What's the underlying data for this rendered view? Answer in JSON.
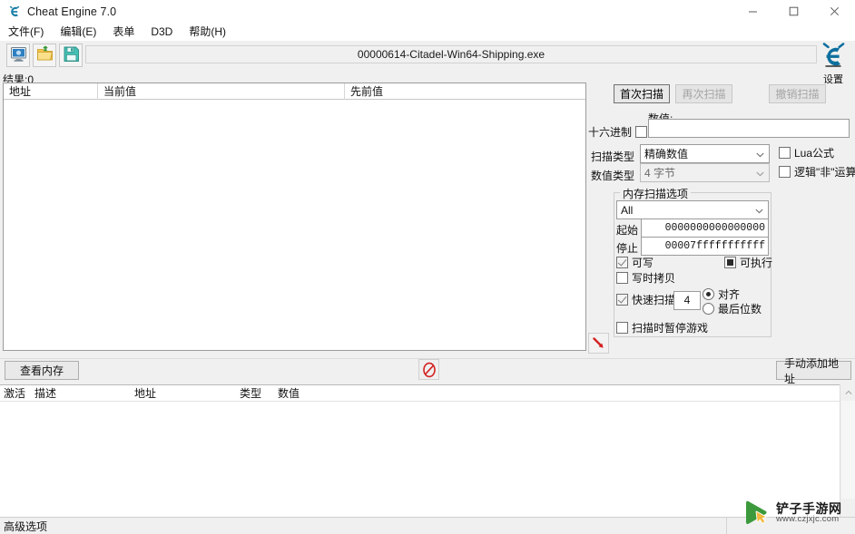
{
  "window": {
    "title": "Cheat Engine 7.0",
    "icon": "cheat-engine-logo-icon",
    "minimize": "–",
    "maximize": "□",
    "close": "✕"
  },
  "menu": {
    "items": [
      {
        "label": "文件(F)",
        "name": "menu-file"
      },
      {
        "label": "编辑(E)",
        "name": "menu-edit"
      },
      {
        "label": "表单",
        "name": "menu-forms"
      },
      {
        "label": "D3D",
        "name": "menu-d3d"
      },
      {
        "label": "帮助(H)",
        "name": "menu-help"
      }
    ]
  },
  "toolbar": {
    "open_process_icon": "monitor-icon",
    "open_file_icon": "open-folder-icon",
    "save_icon": "floppy-save-icon",
    "process_name": "00000614-Citadel-Win64-Shipping.exe"
  },
  "settings": {
    "label": "设置",
    "icon": "cheat-engine-e-icon"
  },
  "results": {
    "count_label": "结果:0",
    "columns": [
      "地址",
      "当前值",
      "先前值"
    ],
    "rows": [],
    "red_arrow_icon": "red-arrow-down-right-icon"
  },
  "scan": {
    "first_scan": "首次扫描",
    "next_scan": "再次扫描",
    "undo_scan": "撤销扫描",
    "hex_label": "十六进制",
    "hex_checked": false,
    "value_label": "数值:",
    "value": "",
    "scan_type_label": "扫描类型",
    "scan_type_value": "精确数值",
    "value_type_label": "数值类型",
    "value_type_value": "4 字节",
    "lua_label": "Lua公式",
    "lua_checked": false,
    "not_label": "逻辑\"非\"运算",
    "not_checked": false
  },
  "memory_options": {
    "group_title": "内存扫描选项",
    "region_value": "All",
    "start_label": "起始",
    "start_value": "0000000000000000",
    "stop_label": "停止",
    "stop_value": "00007fffffffffff",
    "writable_label": "可写",
    "writable_checked": true,
    "executable_label": "可执行",
    "executable_state": "filled",
    "copy_on_write_label": "写时拷贝",
    "copy_on_write_checked": false,
    "fast_scan_label": "快速扫描",
    "fast_scan_checked": true,
    "fast_scan_value": "4",
    "alignment_label": "对齐",
    "alignment_selected": true,
    "last_digits_label": "最后位数",
    "last_digits_selected": false,
    "pause_label": "扫描时暂停游戏",
    "pause_checked": false
  },
  "midbar": {
    "view_memory": "查看内存",
    "no_entry_icon": "red-no-entry-icon",
    "add_address": "手动添加地址"
  },
  "cheat_table": {
    "columns": [
      "激活",
      "描述",
      "地址",
      "类型",
      "数值"
    ],
    "rows": [],
    "scroll_up_icon": "chevron-up-icon"
  },
  "statusbar": {
    "advanced_options": "高级选项"
  },
  "watermark": {
    "logo_icon": "play-cursor-logo-icon",
    "site_name": "铲子手游网",
    "url": "www.czjxjc.com"
  },
  "colors": {
    "accent": "#0a6ea8",
    "window_bg": "#f0f0f0",
    "panel_bg": "#ffffff",
    "red": "#d42121",
    "green": "#3c9a3c"
  }
}
